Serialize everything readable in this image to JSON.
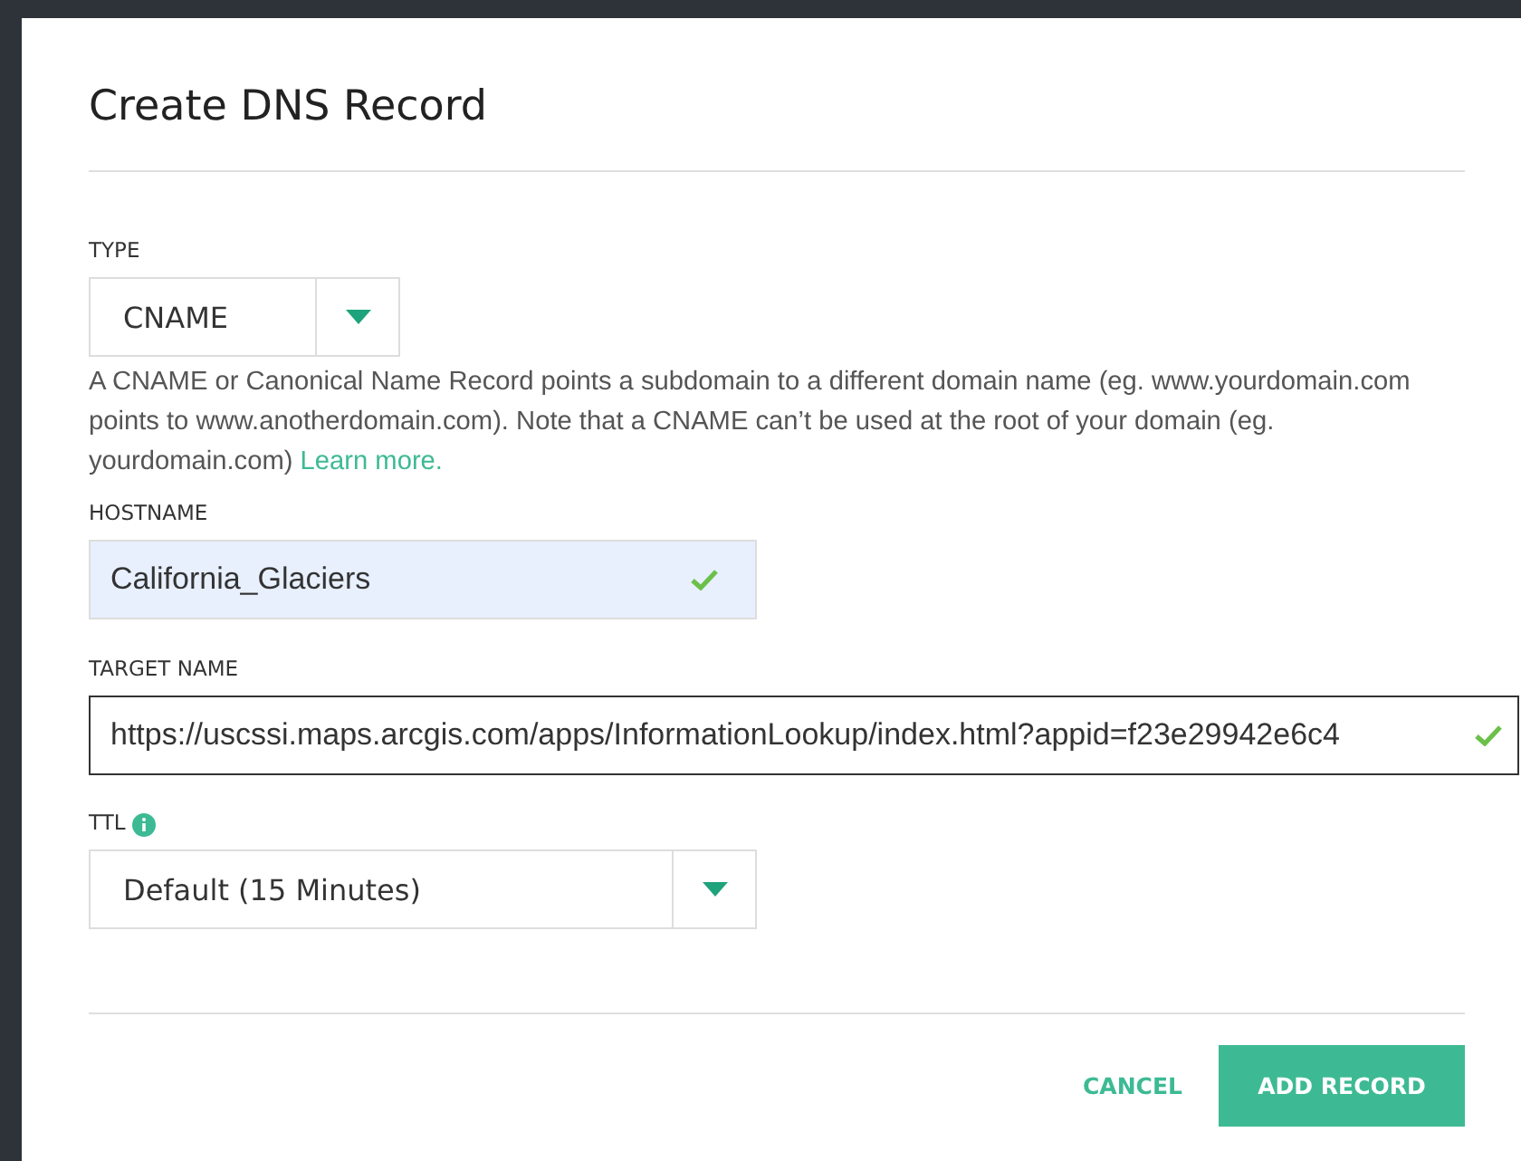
{
  "dialog": {
    "title": "Create DNS Record"
  },
  "type_field": {
    "label": "TYPE",
    "value": "CNAME"
  },
  "description": {
    "text": "A CNAME or Canonical Name Record points a subdomain to a different domain name (eg. www.yourdomain.com points to www.anotherdomain.com). Note that a CNAME can’t be used at the root of your domain (eg. yourdomain.com)",
    "link": "Learn more."
  },
  "hostname": {
    "label": "HOSTNAME",
    "value": "California_Glaciers",
    "valid": true,
    "autofilled": true
  },
  "target_name": {
    "label": "TARGET NAME",
    "value": "https://uscssi.maps.arcgis.com/apps/InformationLookup/index.html?appid=f23e29942e6c4",
    "valid": true,
    "focused": true
  },
  "ttl": {
    "label": "TTL",
    "value": "Default (15 Minutes)",
    "info": true
  },
  "buttons": [
    {
      "label": "CANCEL",
      "kind": "text"
    },
    {
      "label": "ADD RECORD",
      "kind": "primary"
    }
  ]
}
